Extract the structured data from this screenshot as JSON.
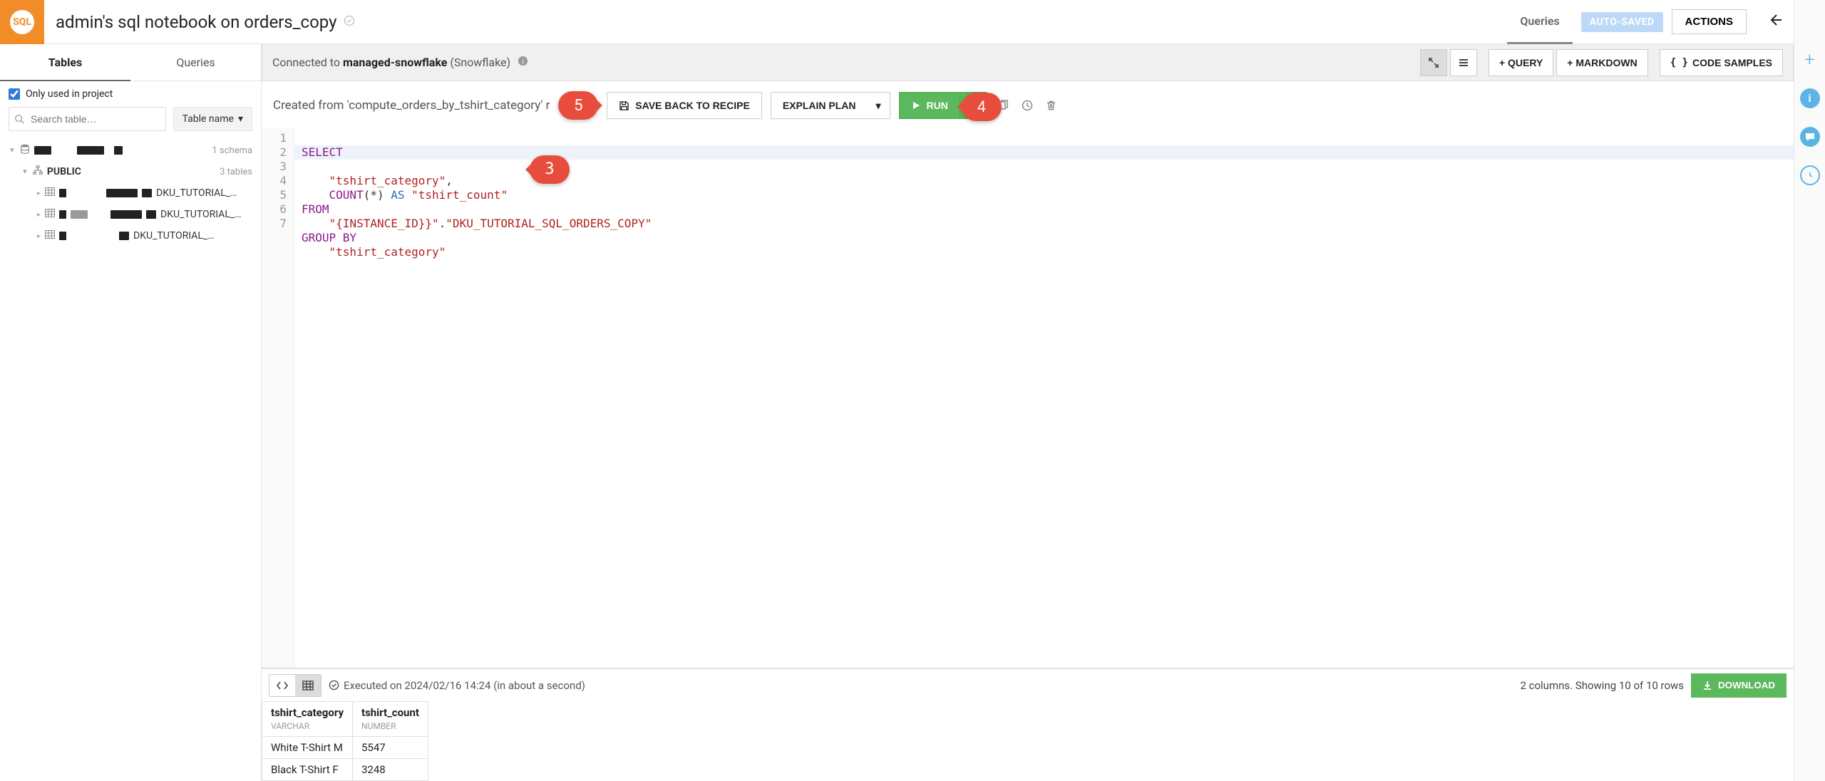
{
  "header": {
    "logo_text": "SQL",
    "title": "admin's sql notebook on orders_copy",
    "queries_tab": "Queries",
    "autosaved": "AUTO-SAVED",
    "actions": "ACTIONS"
  },
  "left": {
    "tabs": {
      "tables": "Tables",
      "queries": "Queries"
    },
    "only_in_project": "Only used in project",
    "search_placeholder": "Search table…",
    "sort_label": "Table name",
    "db_meta1": "1 schema",
    "db_meta2": "3 tables",
    "schema_name": "PUBLIC",
    "table_prefix": "DKU_TUTORIAL_…"
  },
  "conn": {
    "prefix": "Connected to ",
    "name": "managed-snowflake",
    "suffix": " (Snowflake)",
    "plus_query": "+ QUERY",
    "plus_md": "+ MARKDOWN",
    "code_samples": "CODE SAMPLES"
  },
  "actionbar": {
    "created": "Created from 'compute_orders_by_tshirt_category' r",
    "save_recipe": "SAVE BACK TO RECIPE",
    "explain": "EXPLAIN PLAN",
    "run": "RUN"
  },
  "code": {
    "lines": [
      "1",
      "2",
      "3",
      "4",
      "5",
      "6",
      "7"
    ],
    "l1_kw": "SELECT",
    "l2_str": "\"tshirt_category\"",
    "l3_count": "COUNT",
    "l3_star": "(*)",
    "l3_as": " AS ",
    "l3_alias": "\"tshirt_count\"",
    "l4_kw": "FROM",
    "l5_a": "\"{INSTANCE_ID}}\"",
    "l5_b": "\"DKU_TUTORIAL_SQL_ORDERS_COPY\"",
    "l6_kw": "GROUP BY",
    "l7_str": "\"tshirt_category\""
  },
  "results": {
    "exec": "Executed on 2024/02/16 14:24 (in about a second)",
    "summary": "2 columns. Showing 10 of 10 rows",
    "download": "DOWNLOAD",
    "cols": [
      {
        "name": "tshirt_category",
        "type": "VARCHAR"
      },
      {
        "name": "tshirt_count",
        "type": "NUMBER"
      }
    ],
    "rows": [
      {
        "c0": "White T-Shirt M",
        "c1": "5547"
      },
      {
        "c0": "Black T-Shirt F",
        "c1": "3248"
      }
    ]
  },
  "callouts": {
    "c3": "3",
    "c4": "4",
    "c5": "5"
  }
}
